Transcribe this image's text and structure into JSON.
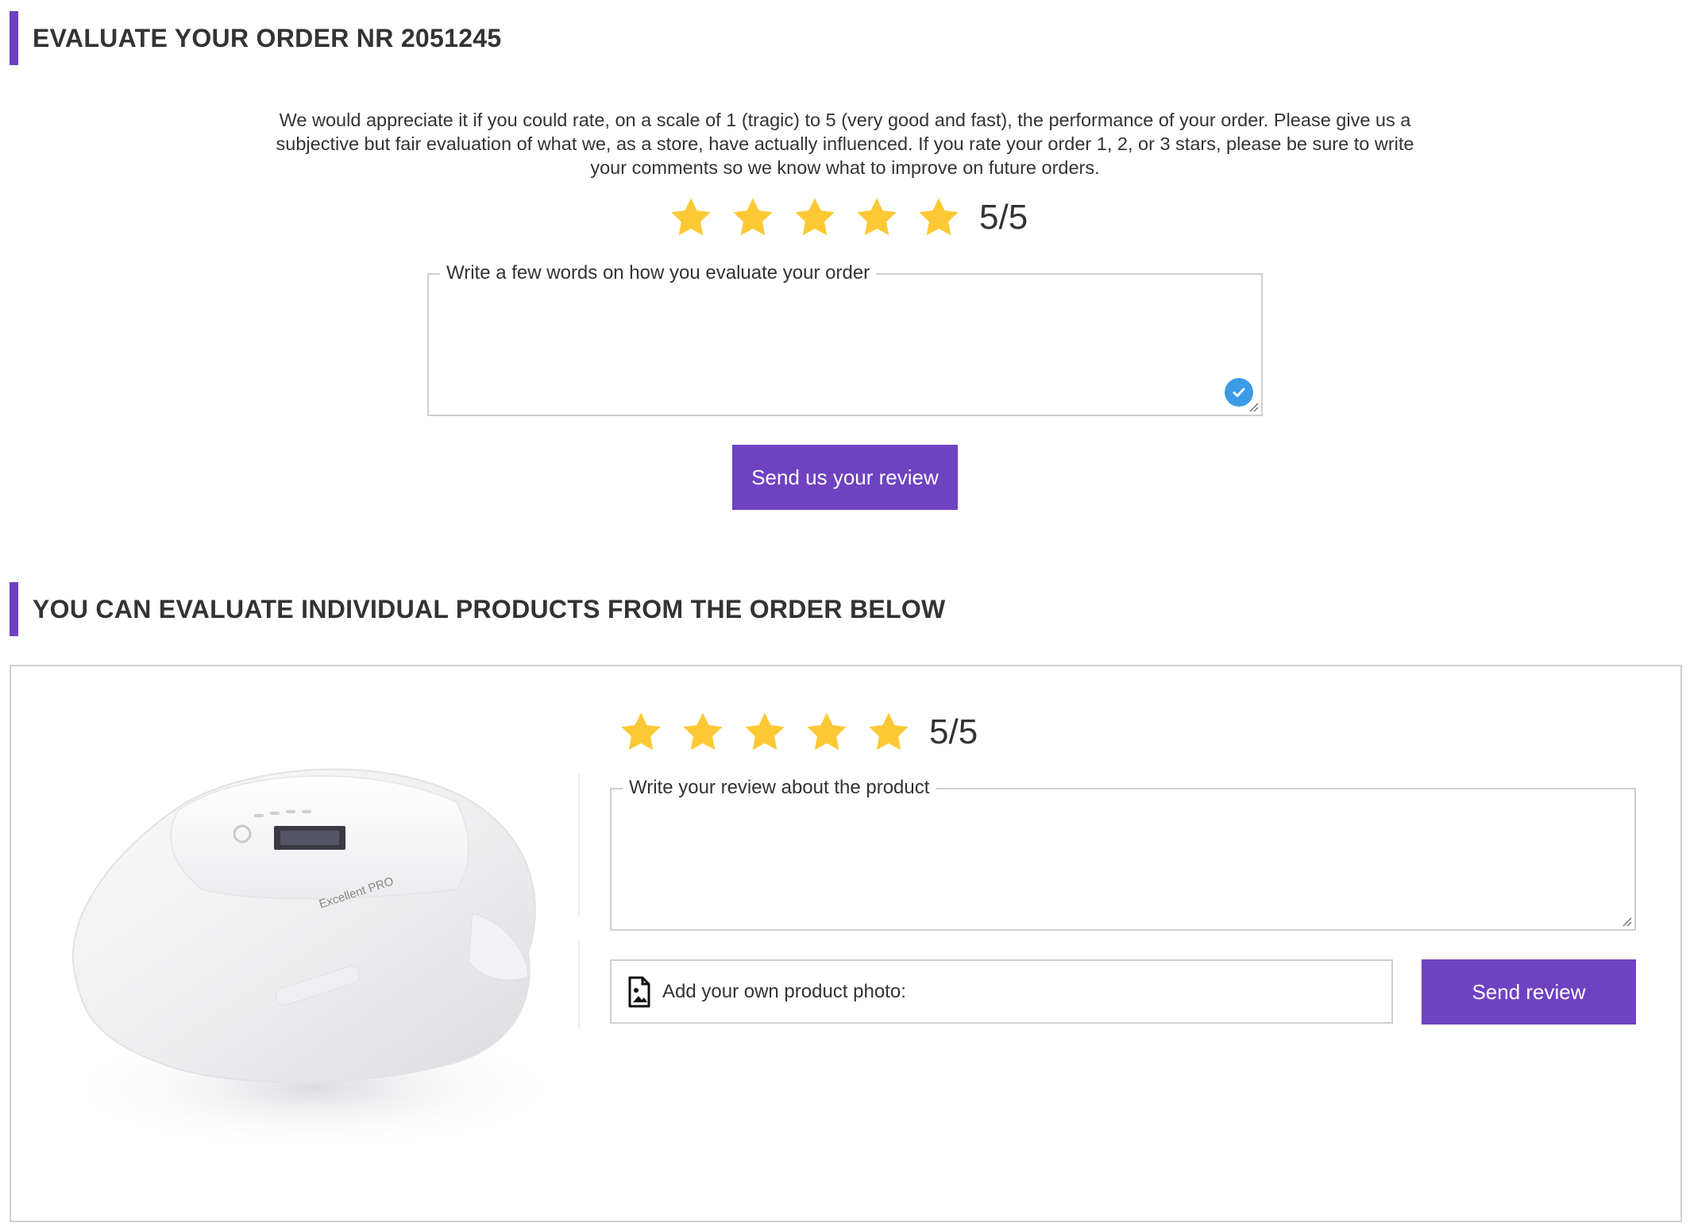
{
  "order_section": {
    "title": "EVALUATE YOUR ORDER NR 2051245",
    "intro": "We would appreciate it if you could rate, on a scale of 1 (tragic) to 5 (very good and fast), the performance of your order. Please give us a subjective but fair evaluation of what we, as a store, have actually influenced. If you rate your order 1, 2, or 3 stars, please be sure to write your comments so we know what to improve on future orders.",
    "rating": {
      "value": 5,
      "max": 5,
      "label": "5/5"
    },
    "comment": {
      "legend": "Write a few words on how you evaluate your order",
      "value": ""
    },
    "submit_label": "Send us your review"
  },
  "products_section": {
    "title": "YOU CAN EVALUATE INDIVIDUAL PRODUCTS FROM THE ORDER BELOW",
    "products": [
      {
        "image_brand_text": "Excellent PRO",
        "rating": {
          "value": 5,
          "max": 5,
          "label": "5/5"
        },
        "review": {
          "legend": "Write your review about the product",
          "value": ""
        },
        "photo_label": "Add your own product photo:",
        "submit_label": "Send review"
      }
    ]
  },
  "colors": {
    "accent": "#6f42c1",
    "star": "#fcc934",
    "check": "#3b9be6"
  }
}
